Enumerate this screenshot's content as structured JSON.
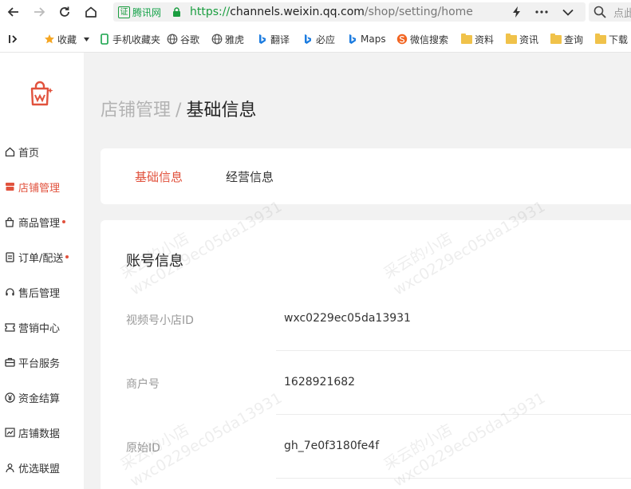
{
  "browser": {
    "url_badge": "腾讯网",
    "url_badge_icon": "证",
    "url_scheme": "https://",
    "url_host": "channels.weixin.qq.com",
    "url_path": "/shop/setting/home",
    "search_placeholder": "点此"
  },
  "bookmarks": [
    {
      "label": "收藏",
      "icon": "star-icon"
    },
    {
      "label": "手机收藏夹",
      "icon": "phone-icon"
    },
    {
      "label": "谷歌",
      "icon": "globe-icon"
    },
    {
      "label": "雅虎",
      "icon": "globe-icon"
    },
    {
      "label": "翻译",
      "icon": "bing-icon"
    },
    {
      "label": "必应",
      "icon": "bing-icon"
    },
    {
      "label": "Maps",
      "icon": "bing-icon"
    },
    {
      "label": "微信搜索",
      "icon": "sogou-icon"
    },
    {
      "label": "资料",
      "icon": "folder-icon"
    },
    {
      "label": "资讯",
      "icon": "folder-icon"
    },
    {
      "label": "查询",
      "icon": "folder-icon"
    },
    {
      "label": "下载",
      "icon": "folder-icon"
    }
  ],
  "sidebar": {
    "items": [
      {
        "label": "首页",
        "icon": "home-icon",
        "active": false,
        "dot": false
      },
      {
        "label": "店铺管理",
        "icon": "store-icon",
        "active": true,
        "dot": false
      },
      {
        "label": "商品管理",
        "icon": "bag-icon",
        "active": false,
        "dot": true
      },
      {
        "label": "订单/配送",
        "icon": "order-icon",
        "active": false,
        "dot": true
      },
      {
        "label": "售后管理",
        "icon": "headset-icon",
        "active": false,
        "dot": false
      },
      {
        "label": "营销中心",
        "icon": "ticket-icon",
        "active": false,
        "dot": false
      },
      {
        "label": "平台服务",
        "icon": "briefcase-icon",
        "active": false,
        "dot": false
      },
      {
        "label": "资金结算",
        "icon": "yen-icon",
        "active": false,
        "dot": false
      },
      {
        "label": "店铺数据",
        "icon": "chart-icon",
        "active": false,
        "dot": false
      },
      {
        "label": "优选联盟",
        "icon": "people-icon",
        "active": false,
        "dot": false
      }
    ]
  },
  "page": {
    "breadcrumb": "店铺管理",
    "separator": "/",
    "title": "基础信息",
    "tabs": [
      {
        "label": "基础信息",
        "active": true
      },
      {
        "label": "经营信息",
        "active": false
      }
    ],
    "section_title": "账号信息",
    "rows": [
      {
        "label": "视频号小店ID",
        "value": "wxc0229ec05da13931"
      },
      {
        "label": "商户号",
        "value": "1628921682"
      },
      {
        "label": "原始ID",
        "value": "gh_7e0f3180fe4f"
      }
    ]
  },
  "watermark": {
    "line1": "采云的小店",
    "line2": "wxc0229ec05da13931"
  },
  "colors": {
    "accent": "#e1523d",
    "url_green": "#1a9d3f",
    "page_bg": "#f2f2f2"
  }
}
